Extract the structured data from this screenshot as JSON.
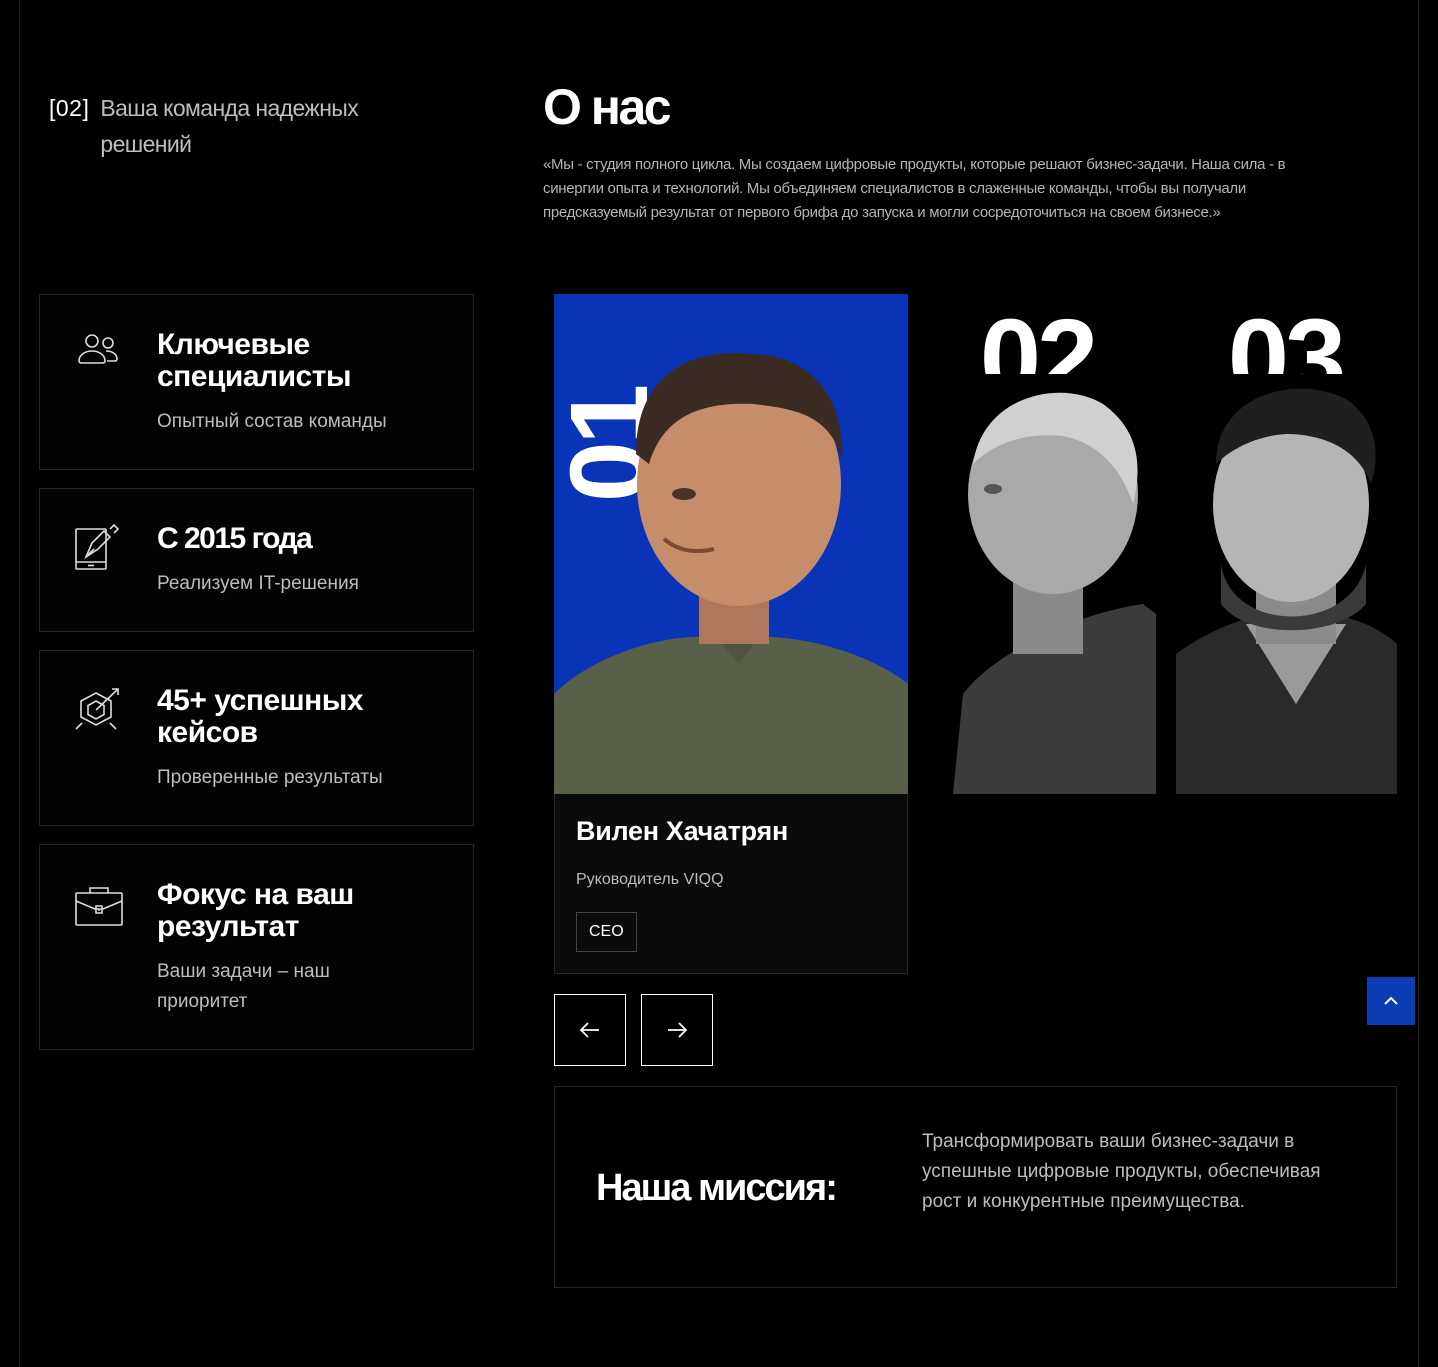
{
  "section": {
    "number": "[02]",
    "label": "Ваша команда надежных решений"
  },
  "about": {
    "title": "О нас",
    "description": "«Мы - студия полного цикла. Мы создаем цифровые продукты, которые решают бизнес-задачи. Наша сила - в синергии опыта и технологий. Мы объединяем специалистов в слаженные команды, чтобы вы получали предсказуемый результат от первого брифа до запуска и могли сосредоточиться на своем бизнесе.»"
  },
  "features": [
    {
      "title": "Ключевые специалисты",
      "subtitle": "Опытный состав команды",
      "icon": "people-icon"
    },
    {
      "title": "С 2015 года",
      "subtitle": "Реализуем IT-решения",
      "icon": "pen-tablet-icon"
    },
    {
      "title": "45+ успешных кейсов",
      "subtitle": "Проверенные результаты",
      "icon": "target-icon"
    },
    {
      "title": "Фокус на ваш результат",
      "subtitle": "Ваши задачи – наш приоритет",
      "icon": "briefcase-icon"
    }
  ],
  "team": {
    "active": {
      "number": "01",
      "name": "Вилен Хачатрян",
      "role": "Руководитель VIQQ",
      "tag": "CEO"
    },
    "others": [
      {
        "number": "02"
      },
      {
        "number": "03"
      }
    ]
  },
  "mission": {
    "title": "Наша миссия:",
    "text": "Трансформировать ваши бизнес-задачи в успешные цифровые продукты, обеспечивая рост и конкурентные преимущества."
  },
  "colors": {
    "accent": "#0a34b8",
    "background": "#000000",
    "muted_text": "#bdbdbd"
  }
}
